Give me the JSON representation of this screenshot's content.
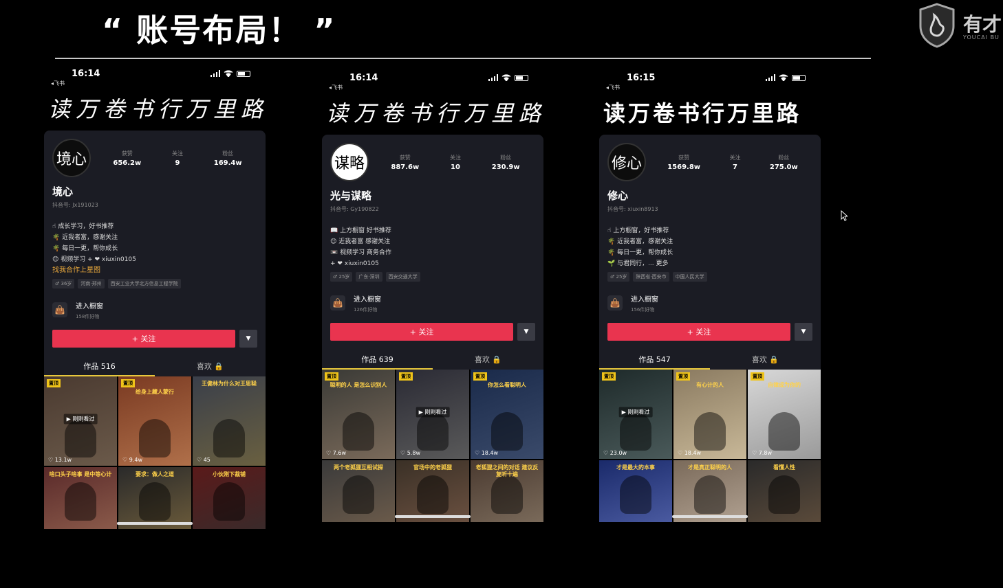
{
  "slide": {
    "title": "“ 账号布局！ ”",
    "brand": "有才",
    "brand_sub": "YOUCAI BU"
  },
  "phones": [
    {
      "time": "16:14",
      "carrier": "◂飞书",
      "calligraphy": "读万卷书行万里路",
      "avatar_text": "境心",
      "stats": [
        {
          "label": "获赞",
          "value": "656.2w"
        },
        {
          "label": "关注",
          "value": "9"
        },
        {
          "label": "粉丝",
          "value": "169.4w"
        }
      ],
      "name": "境心",
      "douyin_id": "抖音号: Jx191023",
      "bio": [
        "☝ 成长学习，好书推荐",
        "🌴 近我者富，感谢关注",
        "🌴 每日一更，帮你成长",
        "😊 视频学习 + ❤ xiuxin0105"
      ],
      "biz": "找我合作上星图",
      "tags": [
        "♂ 36岁",
        "河南·郑州",
        "西安工业大学北方信息工程学院"
      ],
      "shop_title": "进入橱窗",
      "shop_sub": "158件好物",
      "follow": "+ 关注",
      "more": "▼",
      "tab_works": "作品 516",
      "tab_likes": "喜欢 🔒",
      "thumbs": [
        {
          "pin": "置顶",
          "cap": "",
          "likes": "♡ 13.1w",
          "watched": "▶ 刚刚看过"
        },
        {
          "pin": "置顶",
          "cap": "给身上藏人蒙行",
          "likes": "♡ 9.4w",
          "watched": ""
        },
        {
          "pin": "",
          "cap": "王健林为什么对王思聪",
          "likes": "♡ 45",
          "watched": ""
        },
        {
          "pin": "",
          "cap": "啥口头子啥事 是中等心计",
          "likes": "",
          "watched": ""
        },
        {
          "pin": "",
          "cap": "要求：做人之道",
          "likes": "",
          "watched": ""
        },
        {
          "pin": "",
          "cap": "小伙刚下裁铺",
          "likes": "",
          "watched": ""
        }
      ]
    },
    {
      "time": "16:14",
      "carrier": "◂飞书",
      "calligraphy": "读万卷书行万里路",
      "avatar_text": "谋略",
      "stats": [
        {
          "label": "获赞",
          "value": "887.6w"
        },
        {
          "label": "关注",
          "value": "10"
        },
        {
          "label": "粉丝",
          "value": "230.9w"
        }
      ],
      "name": "光与谋略",
      "douyin_id": "抖音号: Gy190822",
      "bio": [
        "📖 上方橱窗  好书推荐",
        "😊 近我者富  感谢关注",
        "📼 视频学习  商务合作",
        "+ ❤ xiuxin0105"
      ],
      "biz": "",
      "tags": [
        "♂ 25岁",
        "广东·深圳",
        "西安交通大学"
      ],
      "shop_title": "进入橱窗",
      "shop_sub": "126件好物",
      "follow": "+ 关注",
      "more": "▼",
      "tab_works": "作品 639",
      "tab_likes": "喜欢 🔒",
      "thumbs": [
        {
          "pin": "置顶",
          "cap": "聪明的人 是怎么识别人",
          "likes": "♡ 7.6w",
          "watched": ""
        },
        {
          "pin": "置顶",
          "cap": "",
          "likes": "♡ 5.8w",
          "watched": "▶ 刚刚看过"
        },
        {
          "pin": "置顶",
          "cap": "你怎么看聪明人",
          "likes": "♡ 18.4w",
          "watched": ""
        },
        {
          "pin": "",
          "cap": "两个老狐狸互相试探",
          "likes": "",
          "watched": ""
        },
        {
          "pin": "",
          "cap": "官场中的老狐狸",
          "likes": "",
          "watched": ""
        },
        {
          "pin": "",
          "cap": "老狐狸之间的对话 建议反复听十遍",
          "likes": "",
          "watched": ""
        }
      ]
    },
    {
      "time": "16:15",
      "carrier": "◂飞书",
      "calligraphy": "读万卷书行万里路",
      "avatar_text": "修心",
      "stats": [
        {
          "label": "获赞",
          "value": "1569.8w"
        },
        {
          "label": "关注",
          "value": "7"
        },
        {
          "label": "粉丝",
          "value": "275.0w"
        }
      ],
      "name": "修心",
      "douyin_id": "抖音号: xiuxin8913",
      "bio": [
        "☝ 上方橱窗，好书推荐",
        "🌴 近我者富，感谢关注",
        "🌴 每日一更，帮你成长",
        "🌱 与君同行，... 更多"
      ],
      "biz": "",
      "tags": [
        "♂ 25岁",
        "陕西省·西安市",
        "中国人民大学"
      ],
      "shop_title": "进入橱窗",
      "shop_sub": "156件好物",
      "follow": "+ 关注",
      "more": "▼",
      "tab_works": "作品 547",
      "tab_likes": "喜欢 🔒",
      "thumbs": [
        {
          "pin": "置顶",
          "cap": "",
          "likes": "♡ 23.0w",
          "watched": "▶ 刚刚看过"
        },
        {
          "pin": "置顶",
          "cap": "有心计的人",
          "likes": "♡ 18.4w",
          "watched": ""
        },
        {
          "pin": "置顶",
          "cap": "自律成为你的",
          "likes": "♡ 7.8w",
          "watched": ""
        },
        {
          "pin": "",
          "cap": "才是最大的本事",
          "likes": "",
          "watched": ""
        },
        {
          "pin": "",
          "cap": "才是真正聪明的人",
          "likes": "",
          "watched": ""
        },
        {
          "pin": "",
          "cap": "看懂人性",
          "likes": "",
          "watched": ""
        }
      ]
    }
  ],
  "colors": {
    "accent_follow": "#e9344f",
    "tab_underline": "#e8c83c",
    "card_bg": "#1b1c24"
  }
}
